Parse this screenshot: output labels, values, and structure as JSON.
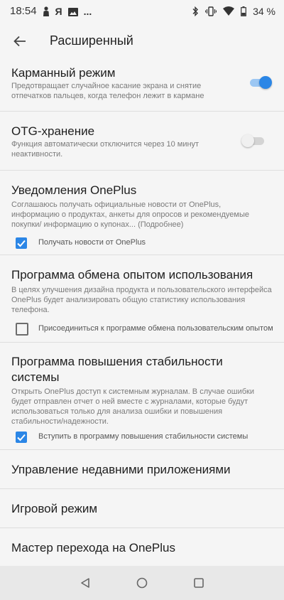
{
  "status_bar": {
    "time": "18:54",
    "notif_letter": "Я",
    "more": "...",
    "battery_text": "34 %"
  },
  "header": {
    "title": "Расширенный"
  },
  "items": [
    {
      "title": "Карманный режим",
      "summary": "Предотвращает случайное касание экрана и снятие отпечатков пальцев, когда телефон лежит в кармане",
      "switch_on": true
    },
    {
      "title": "OTG-хранение",
      "summary": "Функция автоматически отключится через 10 минут неактивности.",
      "switch_on": false
    },
    {
      "title": "Уведомления OnePlus",
      "summary": "Соглашаюсь получать официальные новости от OnePlus, информацию о продуктах, анкеты для опросов и рекомендуемые покупки/ информацию о купонах... (Подробнее)",
      "checkbox_label": "Получать новости от OnePlus",
      "checked": true
    },
    {
      "title": "Программа обмена опытом использования",
      "summary": "В целях улучшения дизайна продукта и пользовательского интерфейса OnePlus будет анализировать общую статистику использования телефона.",
      "checkbox_label": "Присоединиться к программе обмена пользовательским опытом",
      "checked": false
    },
    {
      "title": "Программа повышения стабильности системы",
      "summary": "Открыть OnePlus доступ к системным журналам. В случае ошибки будет отправлен отчет о ней вместе с журналами, которые будут использоваться только для анализа ошибки и повышения стабильности/надежности.",
      "checkbox_label": "Вступить в программу повышения стабильности системы",
      "checked": true
    },
    {
      "title": "Управление недавними приложениями"
    },
    {
      "title": "Игровой режим"
    },
    {
      "title": "Мастер перехода на OnePlus"
    }
  ],
  "colors": {
    "accent": "#2b86e6",
    "accent_track": "#9cc7f3",
    "switch_off_thumb": "#f0f0f0",
    "switch_off_track": "#c9c9c9"
  },
  "icons": {
    "back": "arrow-left-icon",
    "bluetooth": "bluetooth-icon",
    "vibrate": "vibrate-icon",
    "wifi": "wifi-icon",
    "battery": "battery-icon"
  }
}
